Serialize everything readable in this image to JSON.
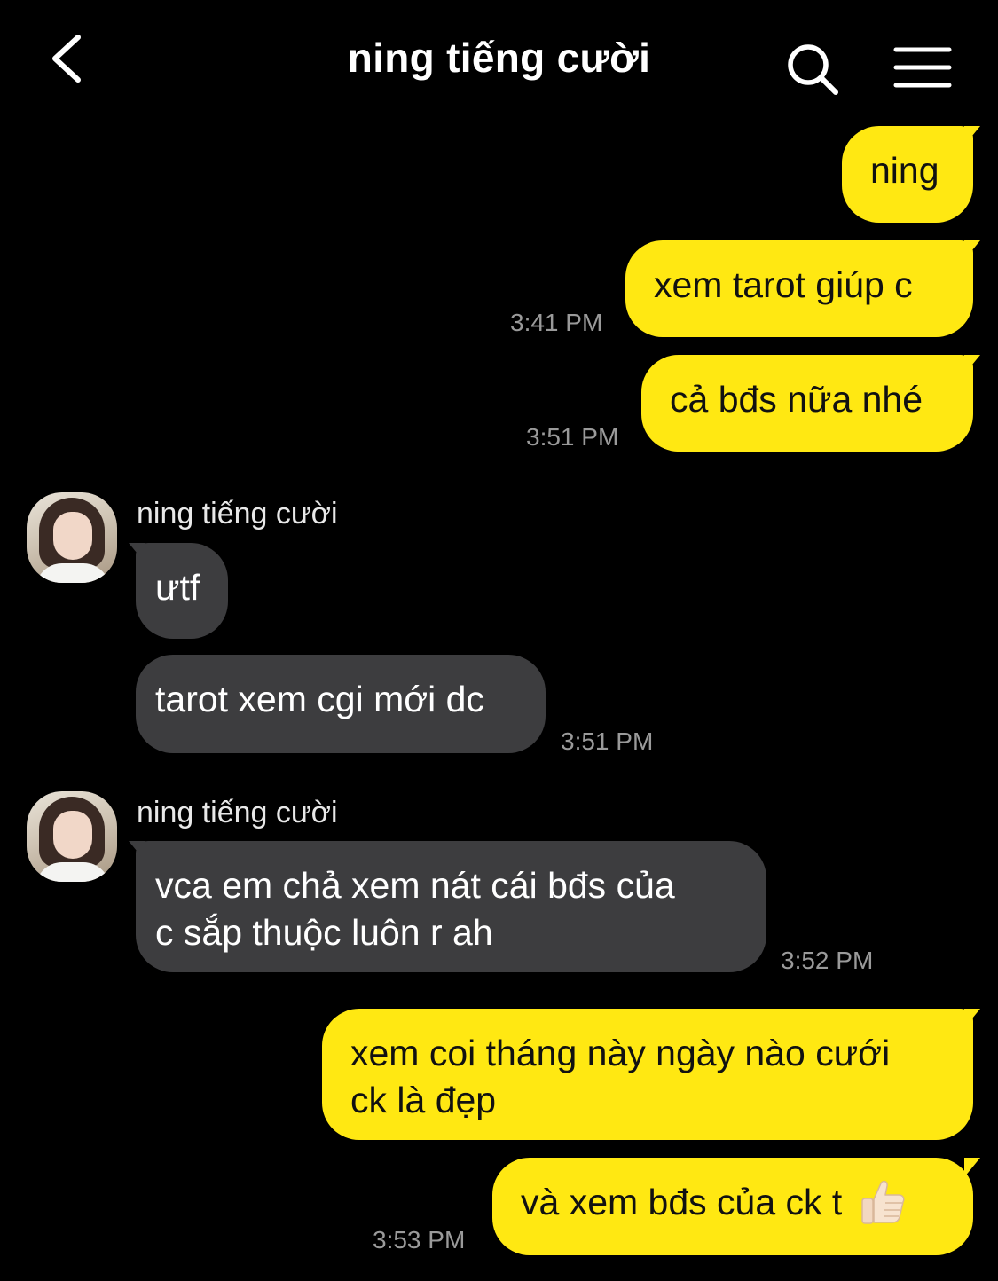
{
  "header": {
    "title": "ning tiếng cười"
  },
  "conversation": {
    "contact_name": "ning tiếng cười",
    "messages": [
      {
        "dir": "out",
        "text": "ning",
        "time": ""
      },
      {
        "dir": "out",
        "text": "xem tarot giúp c",
        "time": "3:41 PM"
      },
      {
        "dir": "out",
        "text": "cả bđs nữa nhé",
        "time": "3:51 PM"
      },
      {
        "dir": "in",
        "text": "ưtf",
        "time": ""
      },
      {
        "dir": "in",
        "text": "tarot xem cgi mới dc",
        "time": "3:51 PM"
      },
      {
        "dir": "in",
        "text_line1": "vca em chả xem nát cái bđs của",
        "text_line2": "c sắp thuộc luôn r ah",
        "time": "3:52 PM"
      },
      {
        "dir": "out",
        "text_line1": "xem coi tháng này ngày nào cưới",
        "text_line2": "ck là đẹp",
        "time": ""
      },
      {
        "dir": "out",
        "text": "và xem bđs của ck t",
        "emoji": "thumbs-up",
        "time": "3:53 PM"
      }
    ]
  },
  "colors": {
    "background": "#000000",
    "outgoing_bubble": "#ffe812",
    "incoming_bubble": "#3d3d3f",
    "timestamp": "#9a9a9a"
  },
  "icons": {
    "back": "chevron-left-icon",
    "search": "search-icon",
    "menu": "hamburger-menu-icon",
    "emoji": "thumbs-up-emoji"
  }
}
